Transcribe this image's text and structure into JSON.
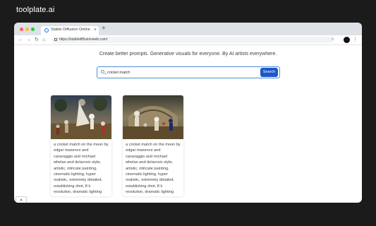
{
  "site_brand": "toolplate.ai",
  "browser": {
    "tab_title": "Stable Diffusion Online",
    "tab_close": "×",
    "new_tab": "+",
    "url": "https://stablediffusionweb.com/",
    "nav": {
      "back": "←",
      "forward": "→",
      "reload": "↻",
      "home": "⌂",
      "star": "☆",
      "menu": "⋮"
    }
  },
  "page": {
    "tagline": "Create better prompts. Generative visuals for everyone. By AI artists everywhere.",
    "search": {
      "value": "cricket match",
      "button_label": "Search"
    },
    "results": [
      {
        "caption": "a cricket match on the moon by edgar maxence and caravaggio and michael whelan and delacroix style, artistic, intricate painting, cinematic lighting, hyper realistic, extremely detailed, establishing shot, 8 k resolution, dramatic lighting"
      },
      {
        "caption": "a cricket match on the moon by edgar maxence and caravaggio and michael whelan and delacroix style, artistic, intricate painting, cinematic lighting, hyper realistic, extremely detailed, establishing shot, 8 k resolution, dramatic lighting"
      }
    ],
    "scroll_tab": "▲"
  }
}
